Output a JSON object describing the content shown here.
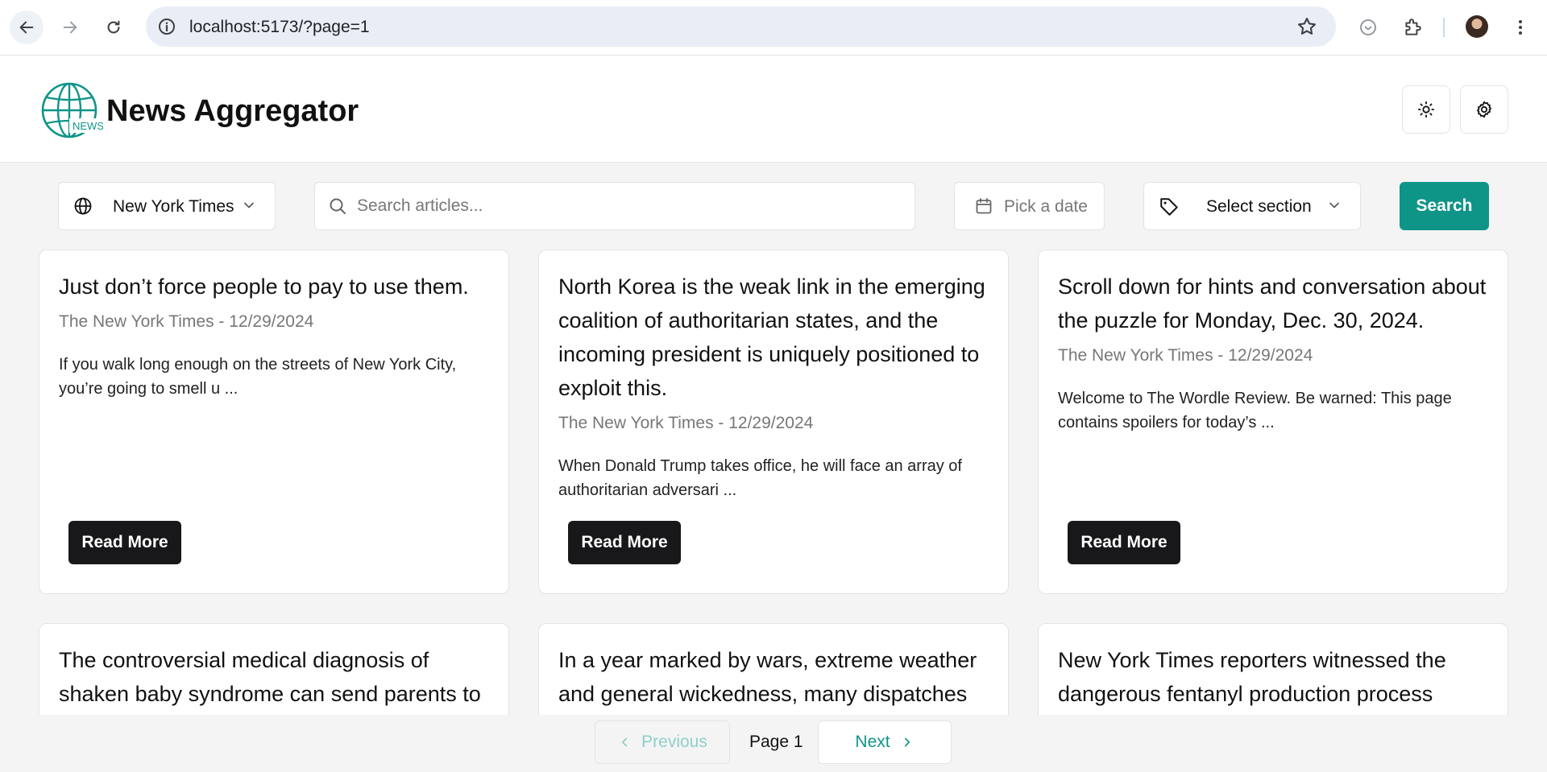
{
  "browser": {
    "url": "localhost:5173/?page=1"
  },
  "app": {
    "title": "News Aggregator",
    "logo_text": "NEWS",
    "accent_color": "#0f9488"
  },
  "filters": {
    "source": "New York Times",
    "search_placeholder": "Search articles...",
    "date_placeholder": "Pick a date",
    "section_placeholder": "Select section",
    "search_button": "Search"
  },
  "articles": [
    {
      "title": "Just don’t force people to pay to use them.",
      "meta": "The New York Times - 12/29/2024",
      "description": "If you walk long enough on the streets of New York City, you’re going to smell u ...",
      "button": "Read More"
    },
    {
      "title": "North Korea is the weak link in the emerging coalition of authoritarian states, and the incoming president is uniquely positioned to exploit this.",
      "meta": "The New York Times - 12/29/2024",
      "description": "When Donald Trump takes office, he will face an array of authoritarian adversari ...",
      "button": "Read More"
    },
    {
      "title": "Scroll down for hints and conversation about the puzzle for Monday, Dec. 30, 2024.",
      "meta": "The New York Times - 12/29/2024",
      "description": "Welcome to The Wordle Review. Be warned: This page contains spoilers for today’s ...",
      "button": "Read More"
    },
    {
      "title": "The controversial medical diagnosis of shaken baby syndrome can send parents to jail. What"
    },
    {
      "title": "In a year marked by wars, extreme weather and general wickedness, many dispatches"
    },
    {
      "title": "New York Times reporters witnessed the dangerous fentanyl production process inside"
    }
  ],
  "pagination": {
    "previous": "Previous",
    "page_label": "Page 1",
    "next": "Next"
  }
}
